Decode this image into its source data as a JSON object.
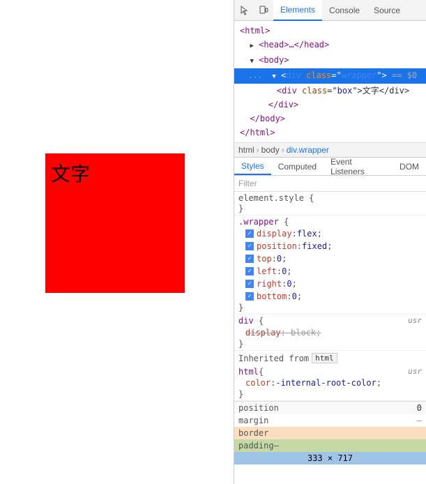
{
  "preview": {
    "chinese_text": "文字"
  },
  "devtools": {
    "top_tabs": {
      "icons": [
        "cursor-icon",
        "device-icon"
      ],
      "tabs": [
        "Elements",
        "Console",
        "Source"
      ]
    },
    "dom": {
      "lines": [
        {
          "indent": 1,
          "content": "<html>",
          "selected": false
        },
        {
          "indent": 1,
          "content": "► <head>…</head>",
          "selected": false
        },
        {
          "indent": 1,
          "content": "▼ <body>",
          "selected": false
        },
        {
          "indent": 2,
          "content": "... ▼ <div class=\"wrapper\"> == $0",
          "selected": true
        },
        {
          "indent": 3,
          "content": "<div class=\"box\">文字</div>",
          "selected": false
        },
        {
          "indent": 2,
          "content": "</div>",
          "selected": false
        },
        {
          "indent": 1,
          "content": "</body>",
          "selected": false
        },
        {
          "indent": 1,
          "content": "</html>",
          "selected": false
        }
      ]
    },
    "breadcrumb": {
      "items": [
        "html",
        "body",
        "div.wrapper"
      ]
    },
    "style_tabs": [
      "Styles",
      "Computed",
      "Event Listeners",
      "DOM"
    ],
    "filter_placeholder": "Filter",
    "styles": {
      "rules": [
        {
          "selector": "element.style {",
          "properties": [],
          "close": "}"
        },
        {
          "selector": ".wrapper {",
          "properties": [
            {
              "checked": true,
              "prop": "display",
              "val": "flex"
            },
            {
              "checked": true,
              "prop": "position",
              "val": "fixed"
            },
            {
              "checked": true,
              "prop": "top",
              "val": "0"
            },
            {
              "checked": true,
              "prop": "left",
              "val": "0"
            },
            {
              "checked": true,
              "prop": "right",
              "val": "0"
            },
            {
              "checked": true,
              "prop": "bottom",
              "val": "0"
            }
          ],
          "close": "}"
        },
        {
          "selector": "div {",
          "properties": [
            {
              "checked": false,
              "strikethrough": true,
              "prop": "display",
              "val": "block"
            }
          ],
          "ua_label": "usr",
          "close": "}"
        }
      ]
    },
    "inherited": {
      "label": "Inherited from",
      "tag": "html"
    },
    "html_rule": {
      "selector": "html {",
      "properties": [
        {
          "prop": "color",
          "val": "-internal-root-color"
        }
      ],
      "ua_label": "usr",
      "close": "}"
    },
    "box_model": {
      "position_label": "position",
      "position_value": "0",
      "margin_label": "margin",
      "margin_value": "–",
      "border_label": "border",
      "padding_label": "padding–",
      "size": "333 × 717"
    }
  }
}
